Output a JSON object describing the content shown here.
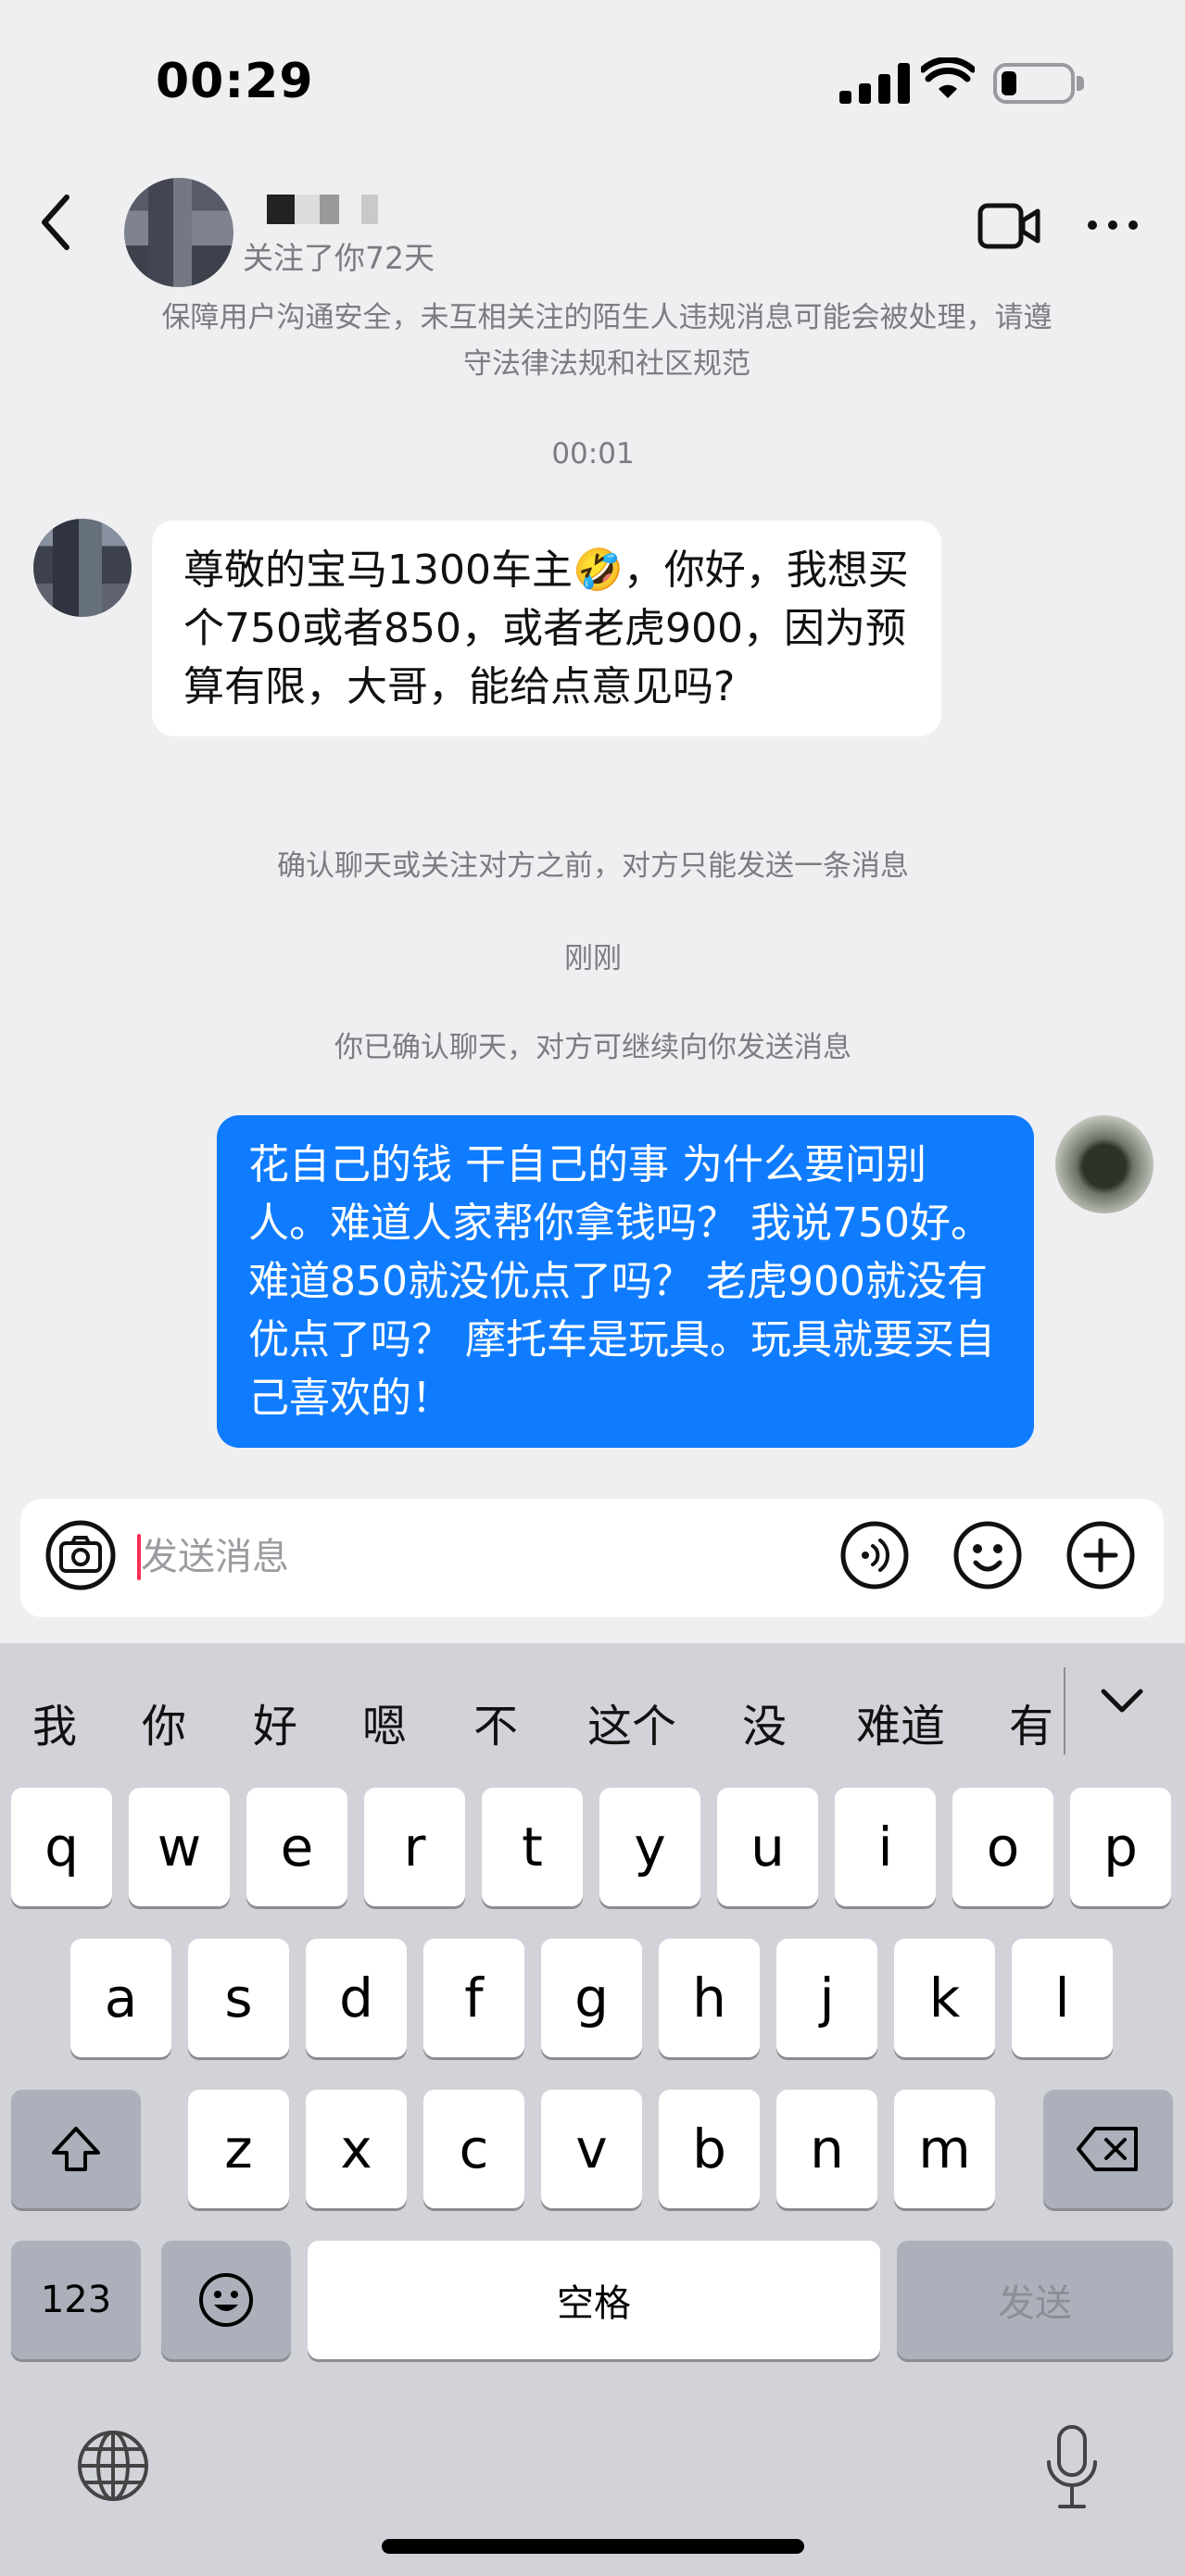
{
  "status_bar": {
    "time": "00:29"
  },
  "header": {
    "subtitle": "关注了你72天"
  },
  "notices": {
    "safety": "保障用户沟通安全，未互相关注的陌生人违规消息可能会被处理，请遵守法律法规和社区规范",
    "time_first": "00:01",
    "one_message_limit": "确认聊天或关注对方之前，对方只能发送一条消息",
    "time_second": "刚刚",
    "confirmed": "你已确认聊天，对方可继续向你发送消息"
  },
  "messages": {
    "incoming": "尊敬的宝马1300车主🤣，你好，我想买个750或者850，或者老虎900，因为预算有限，大哥，能给点意见吗?",
    "outgoing": "花自己的钱 干自己的事 为什么要问别人。难道人家帮你拿钱吗？ 我说750好。 难道850就没优点了吗？ 老虎900就没有优点了吗？ 摩托车是玩具。玩具就要买自己喜欢的！"
  },
  "input": {
    "placeholder": "发送消息",
    "value": ""
  },
  "keyboard": {
    "candidates": [
      "我",
      "你",
      "好",
      "嗯",
      "不",
      "这个",
      "没",
      "难道",
      "有"
    ],
    "row1": [
      "q",
      "w",
      "e",
      "r",
      "t",
      "y",
      "u",
      "i",
      "o",
      "p"
    ],
    "row2": [
      "a",
      "s",
      "d",
      "f",
      "g",
      "h",
      "j",
      "k",
      "l"
    ],
    "row3": [
      "z",
      "x",
      "c",
      "v",
      "b",
      "n",
      "m"
    ],
    "numbers_key": "123",
    "space_key": "空格",
    "send_key": "发送"
  },
  "colors": {
    "outgoing_bubble": "#0f7cff",
    "incoming_bubble": "#ffffff",
    "background": "#efeff1",
    "keyboard": "#d1d3d9"
  },
  "icons": [
    "back-icon",
    "video-call-icon",
    "more-icon",
    "camera-icon",
    "voice-icon",
    "emoji-icon",
    "plus-icon",
    "shift-icon",
    "delete-icon",
    "smiley-icon",
    "globe-icon",
    "microphone-icon",
    "chevron-down-icon"
  ]
}
